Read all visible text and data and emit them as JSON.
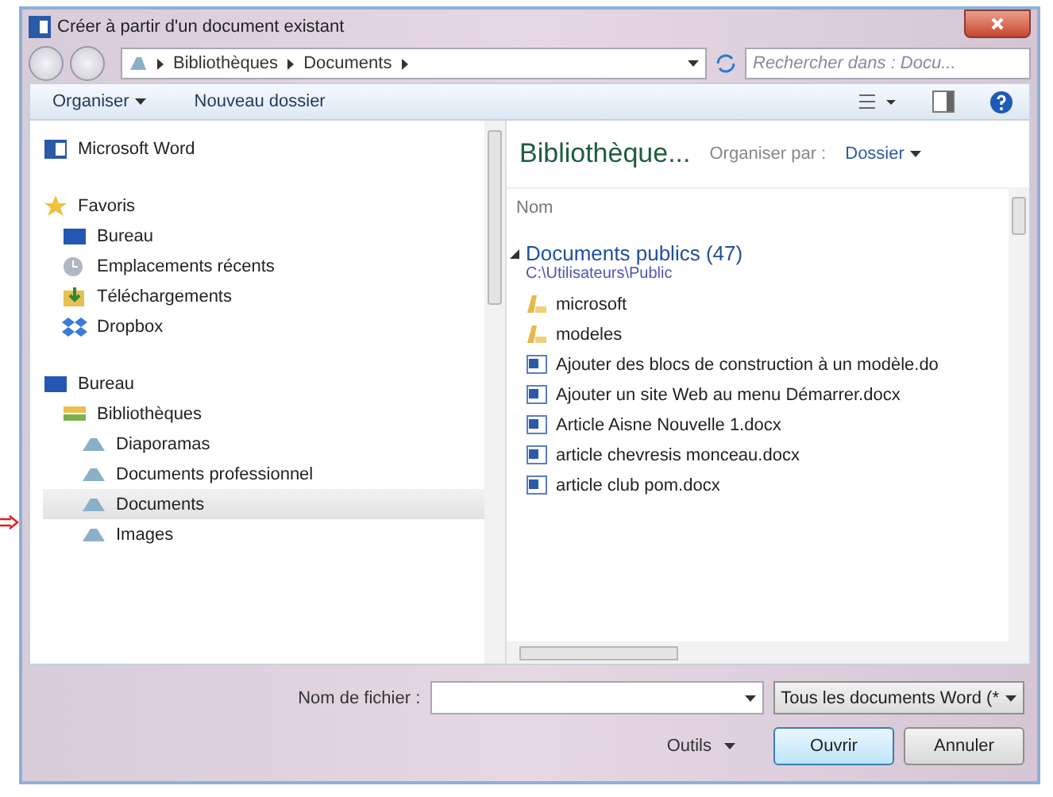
{
  "window": {
    "title": "Créer à partir d'un document existant"
  },
  "address": {
    "breadcrumbs": [
      "Bibliothèques",
      "Documents"
    ],
    "search_placeholder": "Rechercher dans : Docu..."
  },
  "toolbar": {
    "organize": "Organiser",
    "new_folder": "Nouveau dossier"
  },
  "navigation": [
    {
      "label": "Microsoft Word",
      "kind": "word",
      "selected": false
    },
    {
      "label": "Favoris",
      "kind": "star",
      "selected": false,
      "children": [
        {
          "label": "Bureau",
          "kind": "desktop",
          "selected": false
        },
        {
          "label": "Emplacements récents",
          "kind": "recent",
          "selected": false
        },
        {
          "label": "Téléchargements",
          "kind": "download",
          "selected": false
        },
        {
          "label": "Dropbox",
          "kind": "dropbox",
          "selected": false
        }
      ]
    },
    {
      "label": "Bureau",
      "kind": "desktop",
      "selected": false,
      "children": [
        {
          "label": "Bibliothèques",
          "kind": "library",
          "selected": false,
          "children": [
            {
              "label": "Diaporamas",
              "kind": "lib",
              "selected": false
            },
            {
              "label": "Documents professionnel",
              "kind": "lib",
              "selected": false
            },
            {
              "label": "Documents",
              "kind": "lib",
              "selected": true
            },
            {
              "label": "Images",
              "kind": "lib",
              "selected": false
            }
          ]
        }
      ]
    }
  ],
  "content": {
    "heading": "Bibliothèque...",
    "arrange_label": "Organiser par :",
    "arrange_value": "Dossier",
    "column": "Nom",
    "group": {
      "label": "Documents publics (47)",
      "path": "C:\\Utilisateurs\\Public",
      "expanded": true
    },
    "files": [
      {
        "name": "microsoft",
        "kind": "folder"
      },
      {
        "name": "modeles",
        "kind": "folder"
      },
      {
        "name": "Ajouter des blocs de construction à un modèle.do",
        "kind": "doc"
      },
      {
        "name": "Ajouter un site Web au menu Démarrer.docx",
        "kind": "doc"
      },
      {
        "name": "Article Aisne Nouvelle 1.docx",
        "kind": "doc"
      },
      {
        "name": "article chevresis monceau.docx",
        "kind": "doc"
      },
      {
        "name": "article club pom.docx",
        "kind": "doc"
      }
    ]
  },
  "footer": {
    "filename_label": "Nom de fichier :",
    "filter": "Tous les documents Word (*",
    "tools": "Outils",
    "open": "Ouvrir",
    "cancel": "Annuler"
  }
}
